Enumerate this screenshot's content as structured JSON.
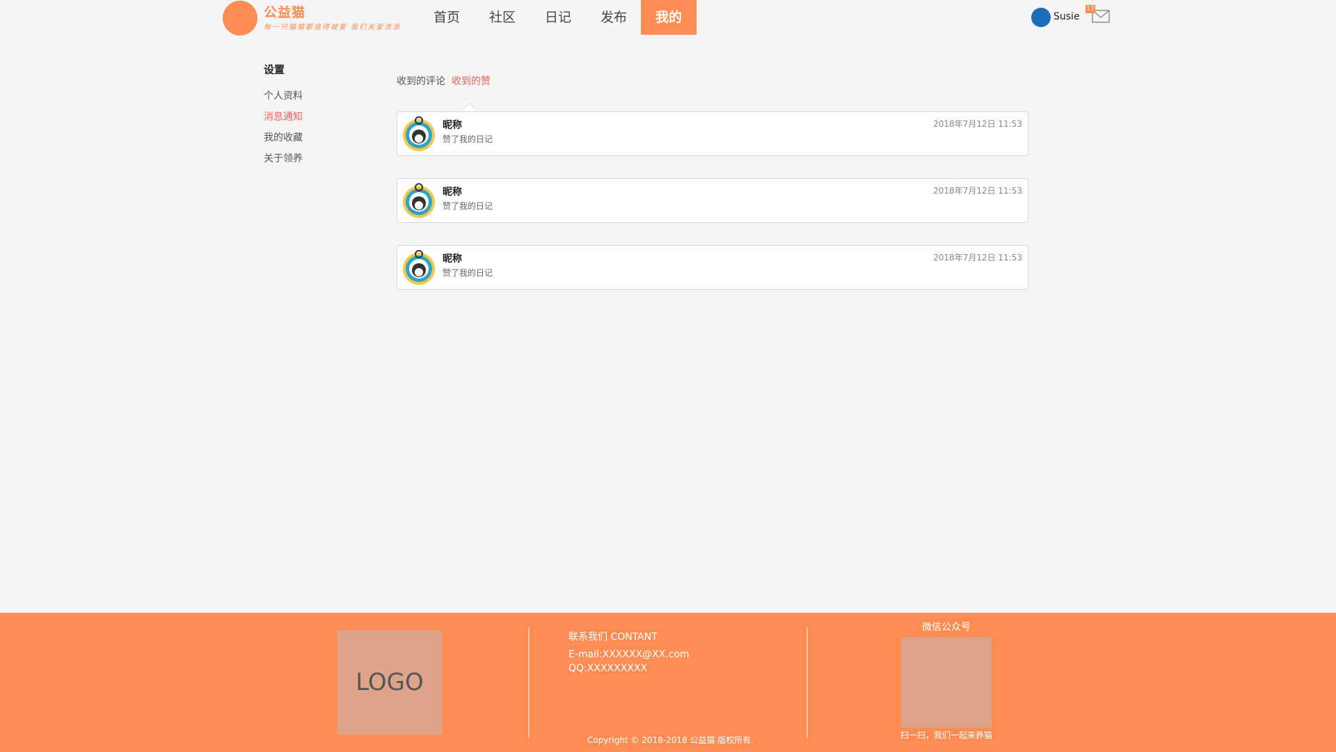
{
  "brand": {
    "name": "公益猫",
    "slogan": "每一只猫猫都值得被爱 我们关爱流浪"
  },
  "nav": {
    "items": [
      {
        "label": "首页"
      },
      {
        "label": "社区"
      },
      {
        "label": "日记"
      },
      {
        "label": "发布"
      },
      {
        "label": "我的",
        "active": true
      }
    ]
  },
  "user": {
    "name": "Susie",
    "mail_count": "17"
  },
  "sidebar": {
    "title": "设置",
    "items": [
      {
        "label": "个人资料"
      },
      {
        "label": "消息通知",
        "active": true
      },
      {
        "label": "我的收藏"
      },
      {
        "label": "关于领养"
      }
    ]
  },
  "tabs": [
    {
      "label": "收到的评论"
    },
    {
      "label": "收到的赞",
      "active": true
    }
  ],
  "notifications": [
    {
      "nickname": "昵称",
      "message": "赞了我的日记",
      "time": "2018年7月12日 11:53"
    },
    {
      "nickname": "昵称",
      "message": "赞了我的日记",
      "time": "2018年7月12日 11:53"
    },
    {
      "nickname": "昵称",
      "message": "赞了我的日记",
      "time": "2018年7月12日 11:53"
    }
  ],
  "footer": {
    "logo_text": "LOGO",
    "contact_title": "联系我们 CONTANT",
    "email": "E-mail:XXXXXX@XX.com",
    "qq": "QQ:XXXXXXXXX",
    "copyright": "Copyright © 2018-2018 公益猫 版权所有.",
    "wechat_title": "微信公众号",
    "wechat_caption": "扫一扫，我们一起来养猫"
  },
  "colors": {
    "accent": "#ff8c52",
    "active_text": "#f0605a",
    "avatar_blue": "#1b6fb8",
    "placeholder": "#dda489"
  },
  "icons": {
    "mail": "mail-icon",
    "avatar": "cat-avatar-icon"
  }
}
